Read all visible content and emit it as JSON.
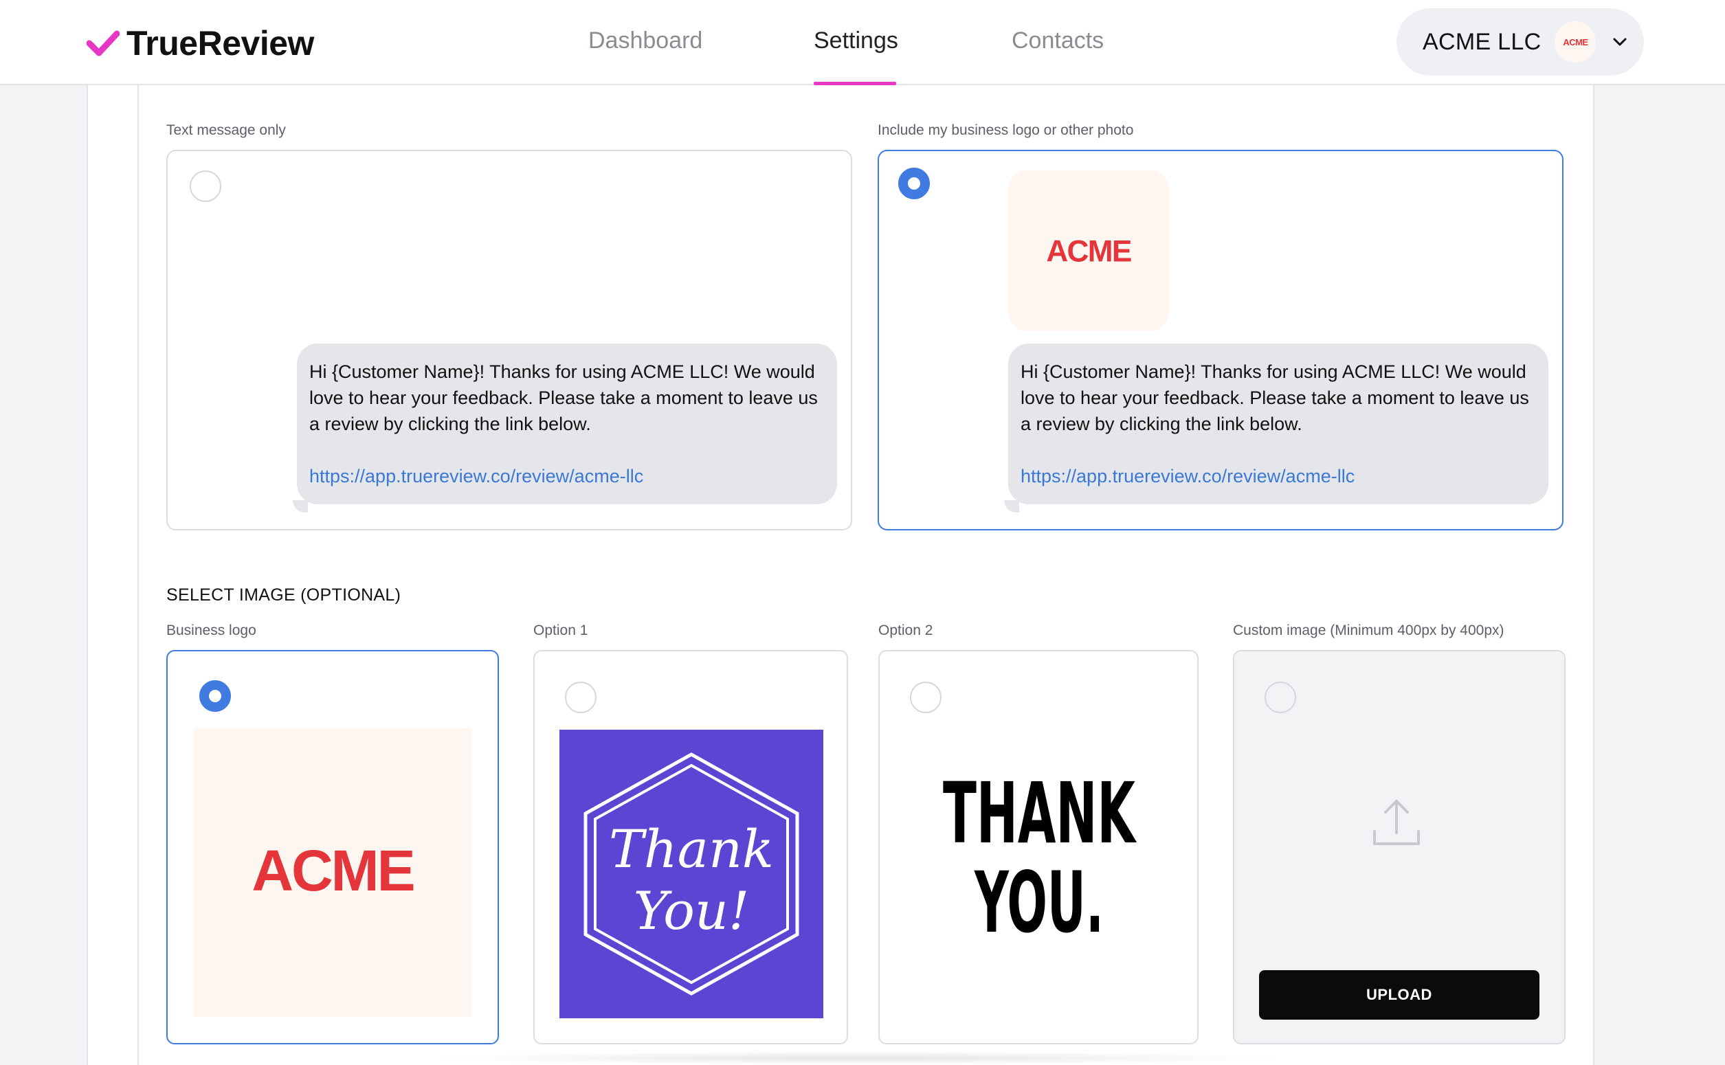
{
  "header": {
    "brand": "TrueReview",
    "brand_color": "#e536c5",
    "nav": [
      {
        "label": "Dashboard",
        "active": false
      },
      {
        "label": "Settings",
        "active": true
      },
      {
        "label": "Contacts",
        "active": false
      }
    ],
    "account": {
      "name": "ACME LLC",
      "avatar_text": "ACME",
      "chevron_icon": "chevron-down-icon"
    }
  },
  "message_options": [
    {
      "label": "Text message only",
      "selected": false,
      "message": "Hi {Customer Name}! Thanks for using ACME LLC! We would love to hear your feedback. Please take a moment to leave us a review by clicking the link below.",
      "link": "https://app.truereview.co/review/acme-llc"
    },
    {
      "label": "Include my business logo or other photo",
      "selected": true,
      "logo_text": "ACME",
      "message": "Hi {Customer Name}! Thanks for using ACME LLC! We would love to hear your feedback. Please take a moment to leave us a review by clicking the link below.",
      "link": "https://app.truereview.co/review/acme-llc"
    }
  ],
  "image_section": {
    "title": "SELECT IMAGE (OPTIONAL)",
    "options": [
      {
        "label": "Business logo",
        "selected": true,
        "image_text": "ACME"
      },
      {
        "label": "Option 1",
        "selected": false,
        "image_text_1": "Thank",
        "image_text_2": "You!"
      },
      {
        "label": "Option 2",
        "selected": false,
        "image_text_1": "THANK",
        "image_text_2": "YOU."
      },
      {
        "label": "Custom image (Minimum 400px by 400px)",
        "selected": false,
        "upload_icon": "upload-icon",
        "button_label": "UPLOAD"
      }
    ]
  },
  "colors": {
    "accent_blue": "#3f7be0",
    "acme_red": "#e3353a",
    "option1_purple": "#5b45d2"
  }
}
